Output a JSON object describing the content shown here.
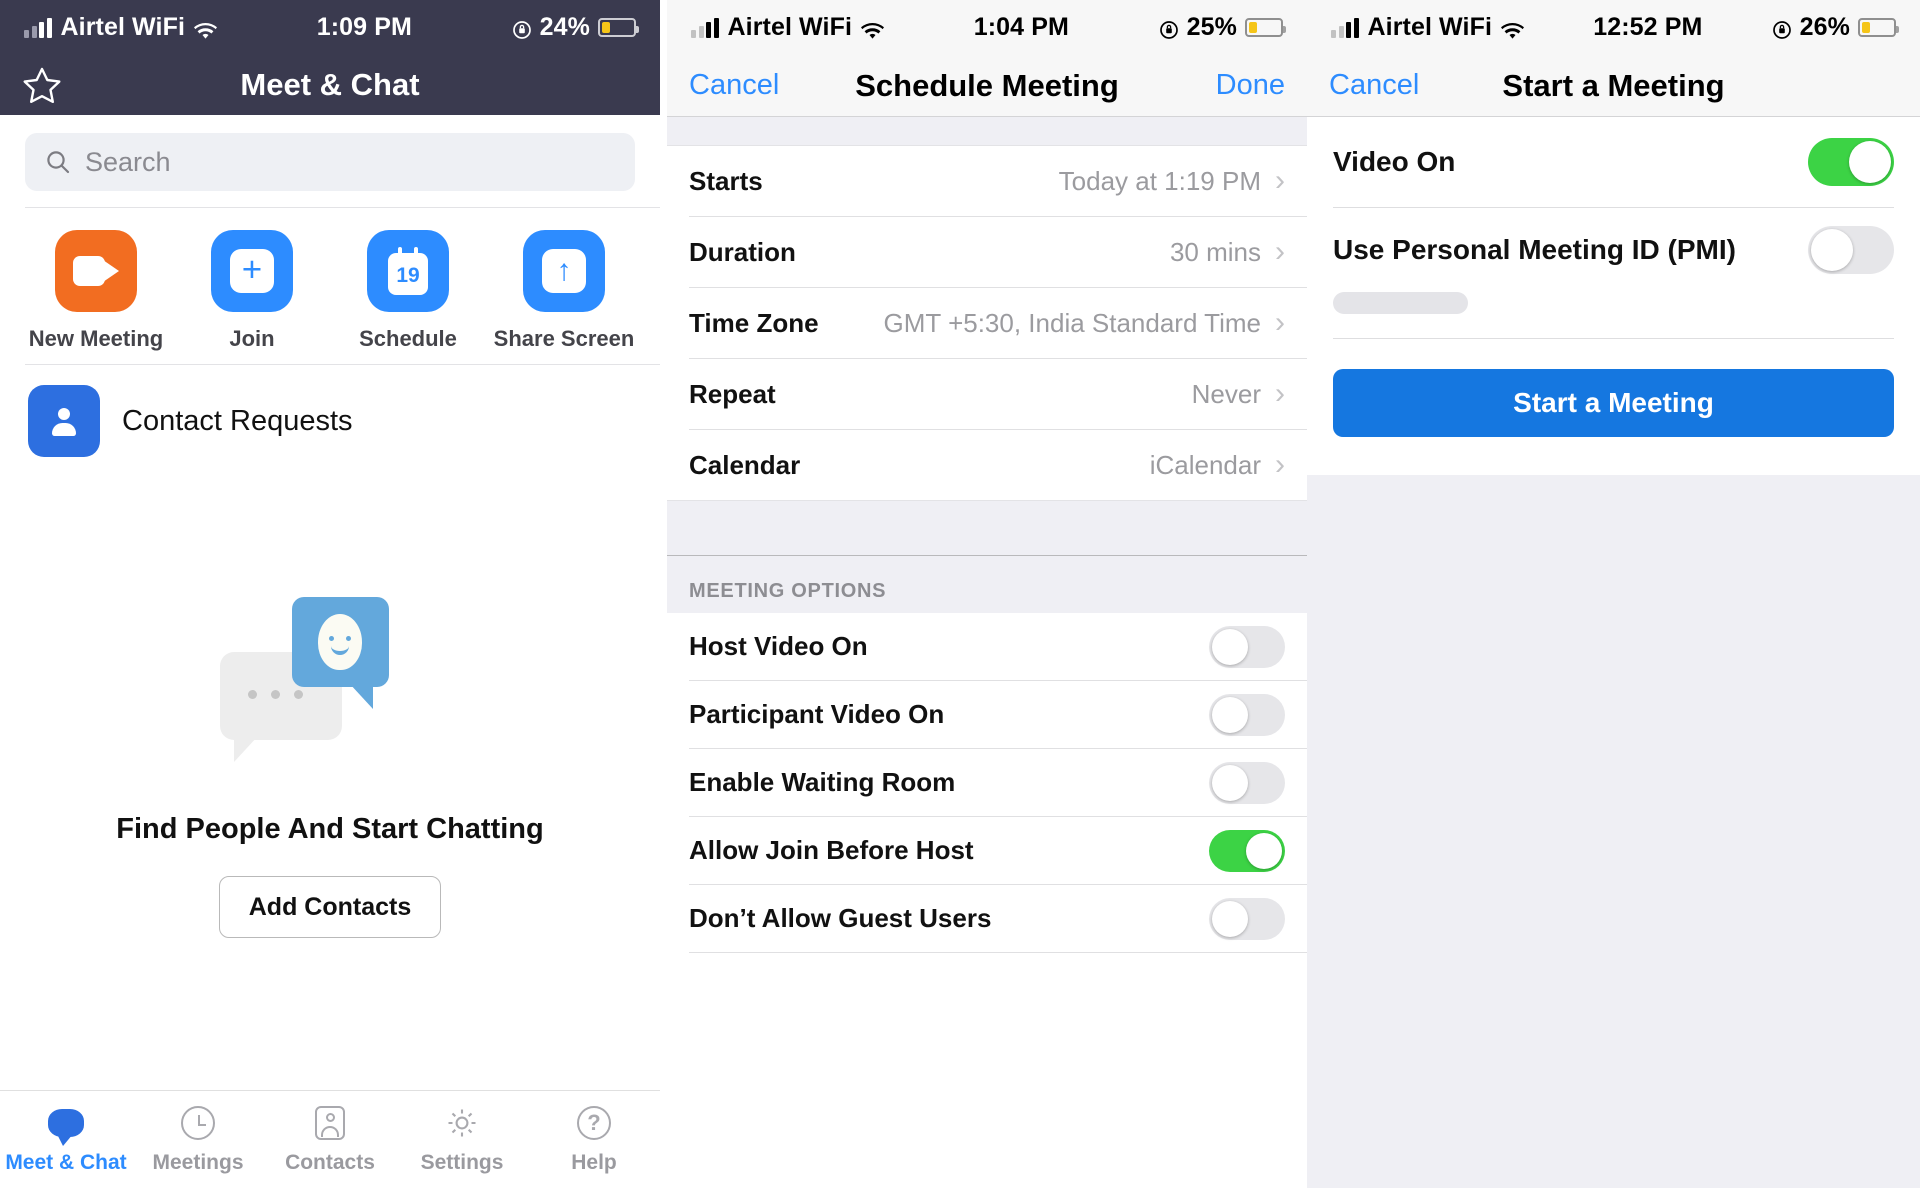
{
  "panels": [
    {
      "status": {
        "carrier": "Airtel WiFi",
        "time": "1:09 PM",
        "battery": "24%"
      },
      "nav": {
        "title": "Meet & Chat",
        "left_icon": "star-icon"
      },
      "search": {
        "placeholder": "Search"
      },
      "tiles": [
        {
          "label": "New Meeting",
          "icon": "video-camera-icon",
          "color": "#F26D21"
        },
        {
          "label": "Join",
          "icon": "plus-icon",
          "color": "#2D8CFF"
        },
        {
          "label": "Schedule",
          "icon": "calendar-icon",
          "day": "19",
          "color": "#2D8CFF"
        },
        {
          "label": "Share Screen",
          "icon": "up-arrow-icon",
          "color": "#2D8CFF"
        }
      ],
      "contact_requests": {
        "label": "Contact Requests",
        "icon": "person-card-icon"
      },
      "empty_state": {
        "illustration": "chat-bubbles-icon",
        "title": "Find People And Start Chatting",
        "button": "Add Contacts"
      },
      "tabs": [
        {
          "label": "Meet & Chat",
          "icon": "chat-bubble-icon",
          "active": true
        },
        {
          "label": "Meetings",
          "icon": "clock-icon",
          "active": false
        },
        {
          "label": "Contacts",
          "icon": "contact-card-icon",
          "active": false
        },
        {
          "label": "Settings",
          "icon": "gear-icon",
          "active": false
        },
        {
          "label": "Help",
          "icon": "question-mark-icon",
          "active": false
        }
      ]
    },
    {
      "status": {
        "carrier": "Airtel WiFi",
        "time": "1:04 PM",
        "battery": "25%"
      },
      "nav": {
        "cancel": "Cancel",
        "title": "Schedule Meeting",
        "done": "Done"
      },
      "detail_rows": [
        {
          "key": "Starts",
          "value": "Today at 1:19 PM"
        },
        {
          "key": "Duration",
          "value": "30 mins"
        },
        {
          "key": "Time Zone",
          "value": "GMT +5:30, India Standard Time"
        },
        {
          "key": "Repeat",
          "value": "Never"
        },
        {
          "key": "Calendar",
          "value": "iCalendar"
        }
      ],
      "section_header": "MEETING OPTIONS",
      "option_rows": [
        {
          "key": "Host Video On",
          "on": false
        },
        {
          "key": "Participant Video On",
          "on": false
        },
        {
          "key": "Enable Waiting Room",
          "on": false
        },
        {
          "key": "Allow Join Before Host",
          "on": true
        },
        {
          "key": "Don’t Allow Guest Users",
          "on": false
        }
      ]
    },
    {
      "status": {
        "carrier": "Airtel WiFi",
        "time": "12:52 PM",
        "battery": "26%"
      },
      "nav": {
        "cancel": "Cancel",
        "title": "Start a Meeting"
      },
      "rows": [
        {
          "key": "Video On",
          "on": true
        },
        {
          "key": "Use Personal Meeting ID (PMI)",
          "on": false,
          "redacted": true
        }
      ],
      "primary_button": "Start a Meeting"
    }
  ],
  "colors": {
    "zoom_blue": "#2D8CFF",
    "zoom_orange": "#F26D21",
    "toggle_green": "#3CD345",
    "navbar_dark": "#3a3a4f",
    "button_blue": "#1577E0",
    "battery_yellow": "#F5C518"
  }
}
